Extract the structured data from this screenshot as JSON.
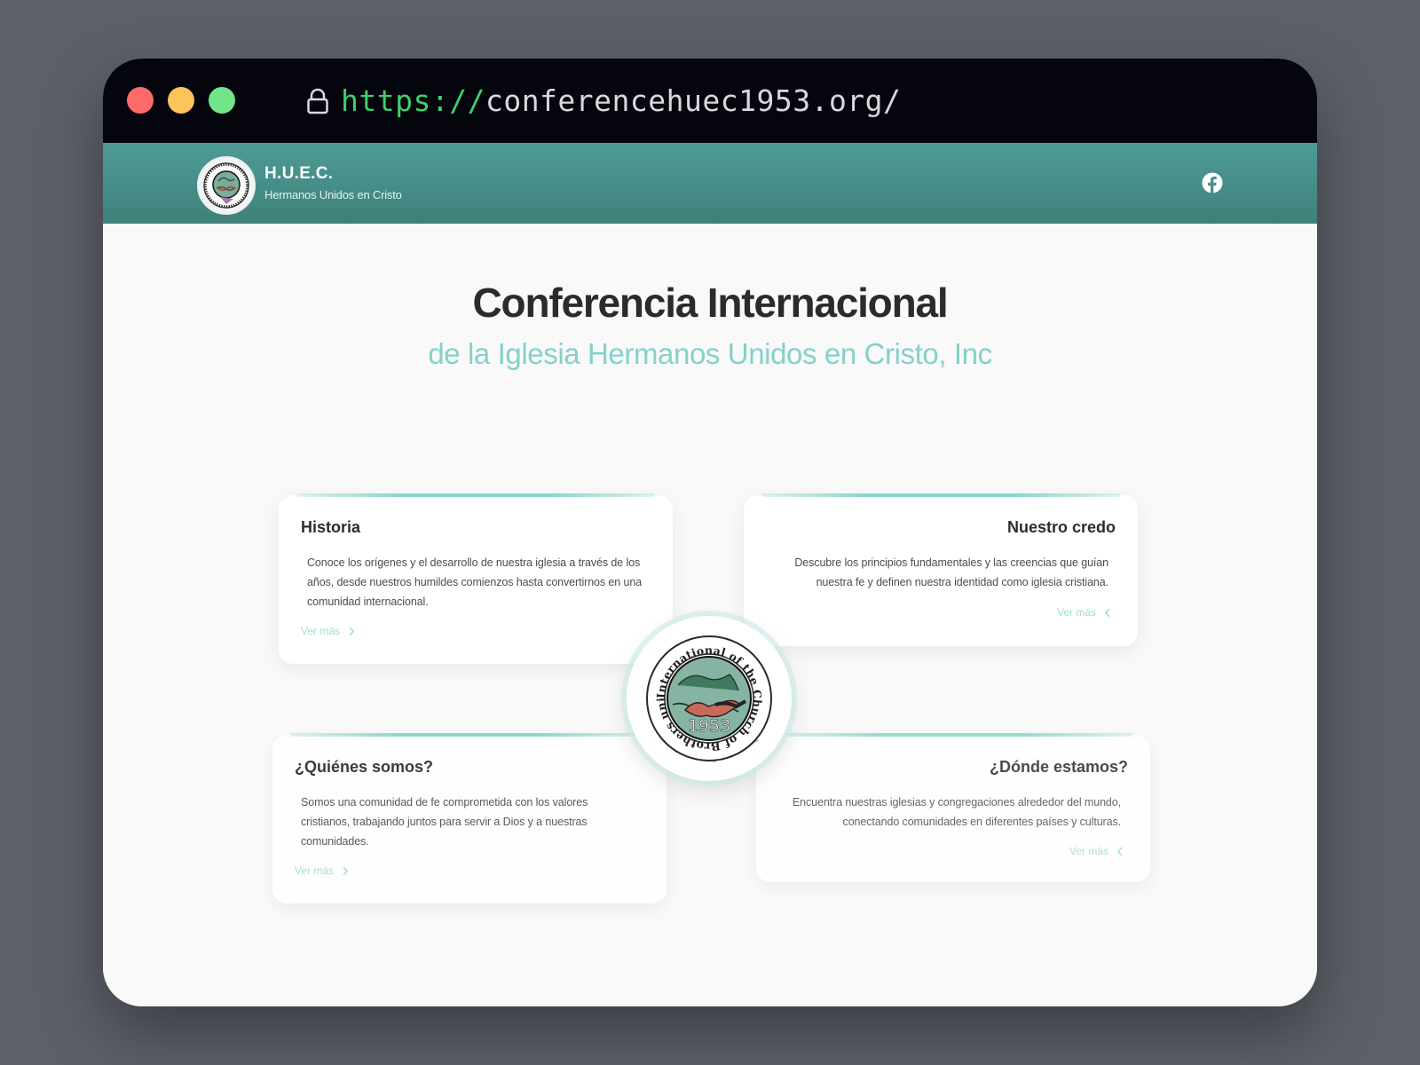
{
  "browser": {
    "url_scheme": "https://",
    "url_host": "conferencehuec1953.org/"
  },
  "navbar": {
    "brand_title": "H.U.E.C.",
    "brand_subtitle": "Hermanos Unidos en Cristo",
    "social_icon": "facebook-icon"
  },
  "hero": {
    "title": "Conferencia Internacional",
    "subtitle": "de la Iglesia Hermanos Unidos en Cristo, Inc"
  },
  "cards": [
    {
      "title": "Historia",
      "text": "Conoce los orígenes y el desarrollo de nuestra iglesia a través de los años, desde nuestros humildes comienzos hasta convertirnos en una comunidad internacional.",
      "link": "Ver más"
    },
    {
      "title": "Nuestro credo",
      "text": "Descubre los principios fundamentales y las creencias que guían nuestra fe y definen nuestra identidad como iglesia cristiana.",
      "link": "Ver más"
    },
    {
      "title": "¿Quiénes somos?",
      "text": "Somos una comunidad de fe comprometida con los valores cristianos, trabajando juntos para servir a Dios y a nuestras comunidades.",
      "link": "Ver más"
    },
    {
      "title": "¿Dónde estamos?",
      "text": "Encuentra nuestras iglesias y congregaciones alrededor del mundo, conectando comunidades en diferentes países y culturas.",
      "link": "Ver más"
    }
  ],
  "seal": {
    "ring_text": "International of the Church of Brothers united in Christ, Inc.",
    "year": "1953"
  },
  "colors": {
    "titlebar": "#05050e",
    "navbar": "#4a928d",
    "accent": "#84d1cc",
    "page_bg": "#f9f9f9"
  }
}
